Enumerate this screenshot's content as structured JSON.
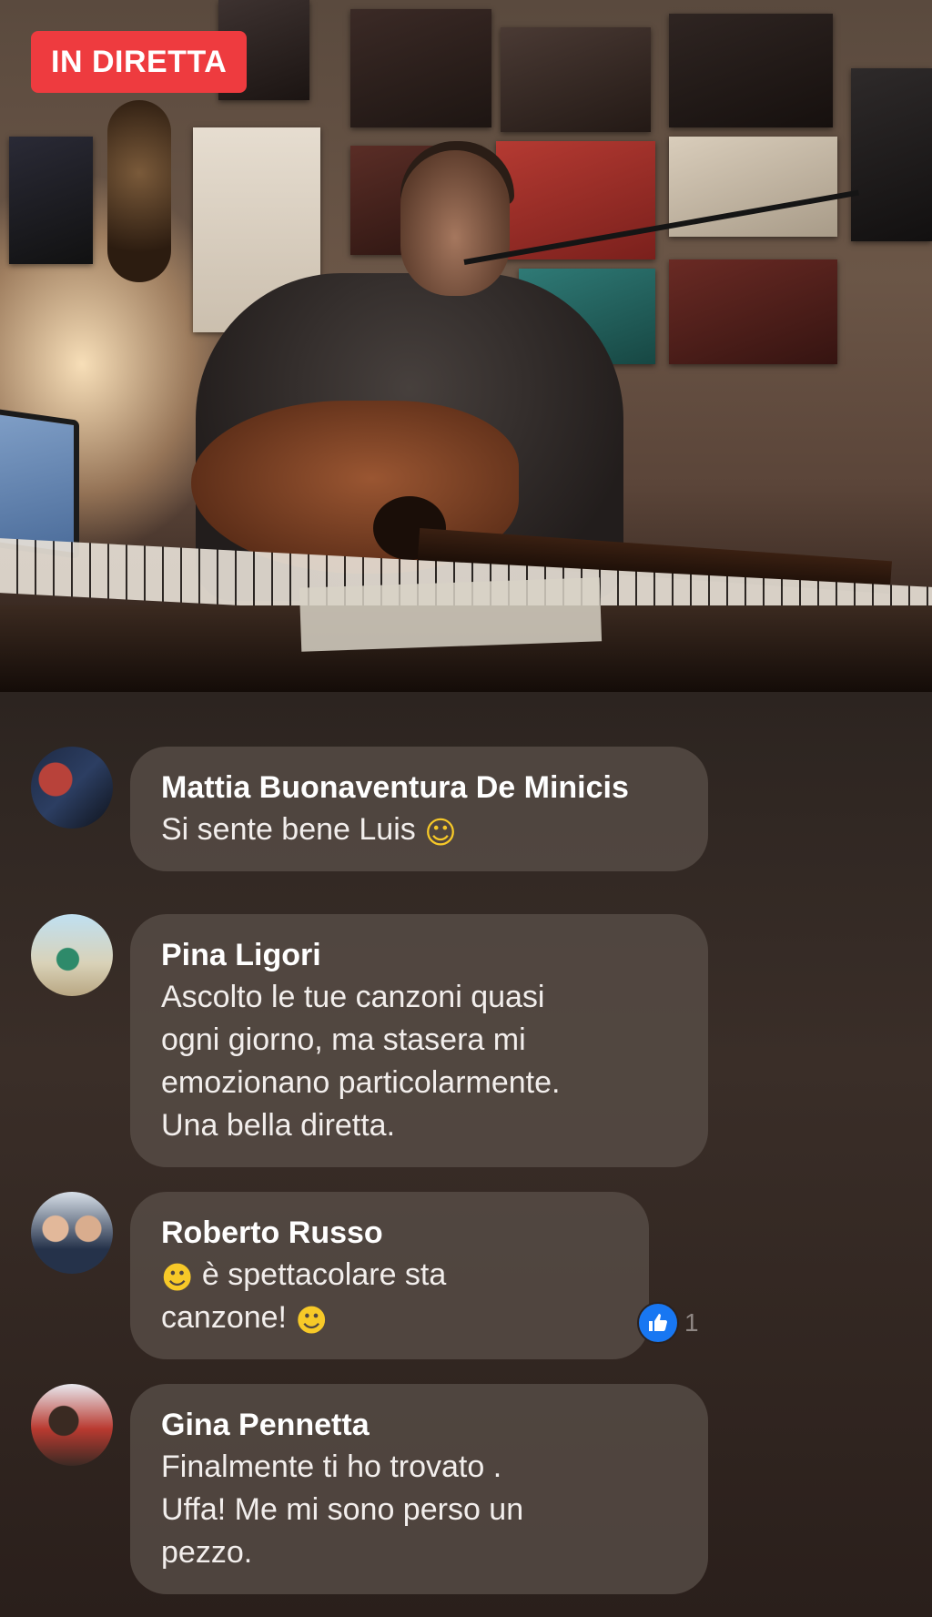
{
  "live": {
    "badge_label": "IN DIRETTA",
    "badge_color": "#ee3b3f"
  },
  "comments": [
    {
      "author": "Mattia Buonaventura De Minicis",
      "lines": [
        "Si sente bene Luis"
      ],
      "trailing_emoji": "slightly-smiling-face"
    },
    {
      "author": "Pina Ligori",
      "lines": [
        "Ascolto le tue canzoni quasi",
        "ogni giorno, ma stasera mi",
        "emozionano particolarmente.",
        "Una bella diretta."
      ]
    },
    {
      "author": "Roberto Russo",
      "line1_text": "è spettacolare sta",
      "line2_text": "canzone!",
      "leading_emoji": "grinning-face",
      "trailing_emoji": "grinning-face",
      "reaction": {
        "type": "like",
        "count": "1",
        "color": "#1877f2"
      }
    },
    {
      "author": "Gina Pennetta",
      "lines": [
        "Finalmente ti ho trovato .",
        "Uffa! Me mi sono perso un",
        "pezzo."
      ]
    }
  ]
}
